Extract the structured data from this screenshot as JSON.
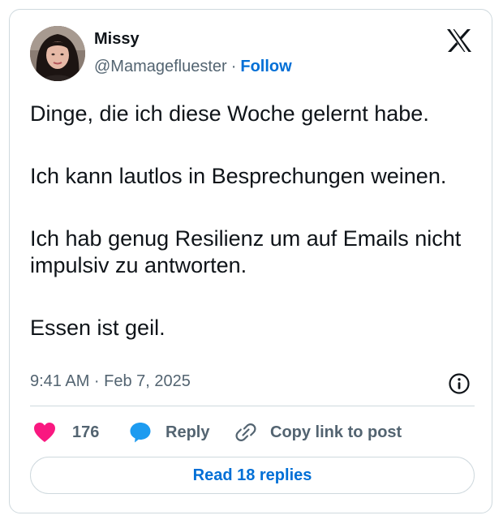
{
  "author": {
    "name": "Missy",
    "handle": "@Mamagefluester",
    "separator": "·",
    "follow_label": "Follow"
  },
  "tweet": {
    "paragraphs": [
      "Dinge, die ich diese Woche gelernt habe.",
      "Ich kann lautlos in Besprechungen weinen.",
      "Ich hab genug Resilienz um auf Emails nicht impulsiv zu antworten.",
      "Essen ist geil."
    ],
    "timestamp": "9:41 AM · Feb 7, 2025"
  },
  "actions": {
    "like_count": "176",
    "reply_label": "Reply",
    "copy_link_label": "Copy link to post"
  },
  "read_replies_label": "Read 18 replies",
  "icons": {
    "logo": "x-logo-icon",
    "info": "info-icon",
    "like": "heart-icon",
    "reply": "speech-bubble-icon",
    "copy": "link-icon"
  },
  "colors": {
    "accent": "#006fd6",
    "like": "#f91880",
    "reply": "#1d9bf0",
    "text": "#0f1419",
    "secondary_text": "#536471",
    "border": "#cfd9de"
  }
}
